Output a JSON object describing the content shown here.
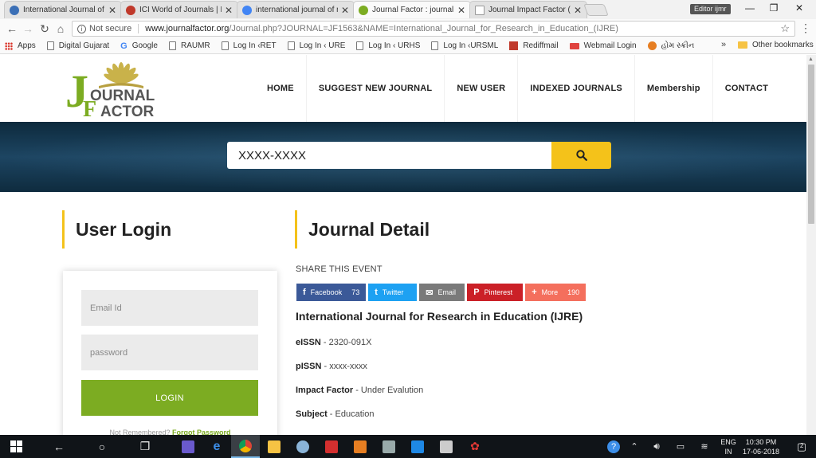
{
  "browser": {
    "tabs": [
      {
        "label": "International Journal of R",
        "active": false,
        "favicon_color": "#3b6fb6"
      },
      {
        "label": "ICI World of Journals | ICI",
        "active": false,
        "favicon_color": "#c0392b"
      },
      {
        "label": "international journal of re",
        "active": false,
        "favicon_color": "#4285f4"
      },
      {
        "label": "Journal Factor : journal N",
        "active": true,
        "favicon_color": "#7cac22"
      },
      {
        "label": "Journal Impact Factor (JI",
        "active": false,
        "favicon_color": "#999999"
      }
    ],
    "profile_label": "Editor ijmr",
    "omnibox": {
      "security_label": "Not secure",
      "url_domain": "www.journalfactor.org",
      "url_path": "/Journal.php?JOURNAL=JF1563&NAME=International_Journal_for_Research_in_Education_(IJRE)"
    },
    "bookmarks": [
      {
        "label": "Apps",
        "icon": "apps-grid-icon"
      },
      {
        "label": "Digital Gujarat",
        "icon": "page-icon"
      },
      {
        "label": "Google",
        "icon": "google-icon"
      },
      {
        "label": "RAUMR",
        "icon": "page-icon"
      },
      {
        "label": "Log In ‹RET",
        "icon": "page-icon"
      },
      {
        "label": "Log In ‹ URE",
        "icon": "page-icon"
      },
      {
        "label": "Log In ‹ URHS",
        "icon": "page-icon"
      },
      {
        "label": "Log In ‹URSML",
        "icon": "page-icon"
      },
      {
        "label": "Rediffmail",
        "icon": "rediff-icon"
      },
      {
        "label": "Webmail Login",
        "icon": "webmail-icon"
      },
      {
        "label": "હોમ સ્ક્રીન",
        "icon": "orange-icon"
      }
    ],
    "bookmarks_overflow": "»",
    "other_bookmarks": "Other bookmarks"
  },
  "site": {
    "logo": {
      "line1": "OURNAL",
      "line2": "ACTOR",
      "j_letter": "J",
      "f_letter": "F"
    },
    "nav": [
      "HOME",
      "SUGGEST NEW JOURNAL",
      "NEW USER",
      "INDEXED JOURNALS",
      "Membership",
      "CONTACT"
    ],
    "search": {
      "placeholder": "XXXX-XXXX"
    },
    "login": {
      "heading": "User Login",
      "email_placeholder": "Email Id",
      "password_placeholder": "password",
      "button_label": "LOGIN",
      "forgot_prefix": "Not Remembered?",
      "forgot_link": "Forgot Password"
    },
    "detail": {
      "heading": "Journal Detail",
      "share_label": "SHARE THIS EVENT",
      "share_buttons": [
        {
          "label": "Facebook",
          "count": "73",
          "icon": "f",
          "color": "#3b5998"
        },
        {
          "label": "Twitter",
          "count": "",
          "icon": "t",
          "color": "#1da1f2"
        },
        {
          "label": "Email",
          "count": "",
          "icon": "✉",
          "color": "#7a7a7a"
        },
        {
          "label": "Pinterest",
          "count": "",
          "icon": "P",
          "color": "#cb2027"
        },
        {
          "label": "More",
          "count": "190",
          "icon": "+",
          "color": "#f46f5d"
        }
      ],
      "journal_title": "International Journal for Research in Education (IJRE)",
      "fields": [
        {
          "label": "eISSN",
          "value": "2320-091X"
        },
        {
          "label": "pISSN",
          "value": "xxxx-xxxx"
        },
        {
          "label": "Impact Factor",
          "value": "Under Evalution"
        },
        {
          "label": "Subject",
          "value": "Education"
        }
      ]
    }
  },
  "taskbar": {
    "language_line1": "ENG",
    "language_line2": "IN",
    "time": "10:30 PM",
    "date": "17-06-2018",
    "notification_count": "2"
  }
}
